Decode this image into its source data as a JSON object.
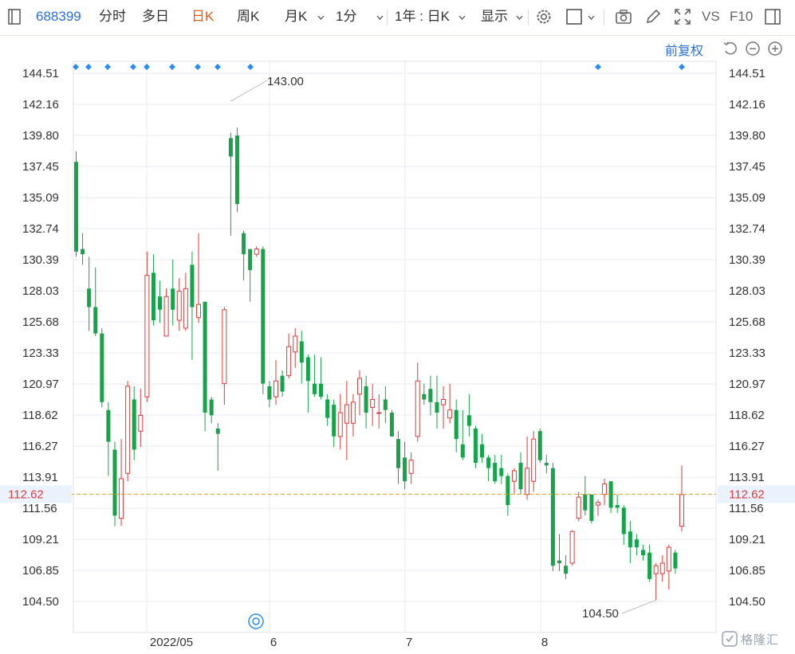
{
  "toolbar": {
    "stock_code": "688399",
    "tabs": [
      "分时",
      "多日",
      "日K",
      "周K",
      "月K",
      "1分"
    ],
    "active_tab": "日K",
    "period_select": "1年 : 日K",
    "display_label": "显示",
    "vs_label": "VS",
    "f10_label": "F10",
    "adjust_label": "前复权"
  },
  "colors": {
    "up": "#e03a3a",
    "down": "#17a34a",
    "grid": "#e8ebf0",
    "marker": "#2a8ef0",
    "price_line": "#d9a441",
    "price_label": "#e03a3a"
  },
  "chart_data": {
    "type": "candlestick",
    "y_ticks": [
      "144.51",
      "142.16",
      "139.80",
      "137.45",
      "135.09",
      "132.74",
      "130.39",
      "128.03",
      "125.68",
      "123.33",
      "120.97",
      "118.62",
      "116.27",
      "113.91",
      "111.56",
      "109.21",
      "106.85",
      "104.50"
    ],
    "x_labels": [
      "2022/05",
      "6",
      "7",
      "8"
    ],
    "current_price": "112.62",
    "high_label": "143.00",
    "low_label": "104.50",
    "candles": [
      [
        137.8,
        131.0,
        138.6,
        130.6
      ],
      [
        131.2,
        130.8,
        132.4,
        130.0
      ],
      [
        128.2,
        126.8,
        130.6,
        125.0
      ],
      [
        126.8,
        124.8,
        129.8,
        124.6
      ],
      [
        124.8,
        119.6,
        125.2,
        119.2
      ],
      [
        119.0,
        116.6,
        119.6,
        114.0
      ],
      [
        116.0,
        111.0,
        116.6,
        110.2
      ],
      [
        110.8,
        113.8,
        116.8,
        110.2
      ],
      [
        114.2,
        120.8,
        121.2,
        113.6
      ],
      [
        119.8,
        116.0,
        120.8,
        115.2
      ],
      [
        117.4,
        118.6,
        120.6,
        116.2
      ],
      [
        120.0,
        129.2,
        131.0,
        119.6
      ],
      [
        129.4,
        125.8,
        130.8,
        125.4
      ],
      [
        127.6,
        126.6,
        128.8,
        125.6
      ],
      [
        124.6,
        127.6,
        128.2,
        124.6
      ],
      [
        128.2,
        126.6,
        130.4,
        125.4
      ],
      [
        125.8,
        128.0,
        129.0,
        125.0
      ],
      [
        125.2,
        128.2,
        129.4,
        125.0
      ],
      [
        130.0,
        126.8,
        131.0,
        122.8
      ],
      [
        126.0,
        127.0,
        132.4,
        125.6
      ],
      [
        127.2,
        118.8,
        127.2,
        117.4
      ],
      [
        119.8,
        118.6,
        120.0,
        118.0
      ],
      [
        117.6,
        117.2,
        118.0,
        114.4
      ],
      [
        121.0,
        126.6,
        126.8,
        119.4
      ],
      [
        139.6,
        138.2,
        140.0,
        132.2
      ],
      [
        139.8,
        134.6,
        140.4,
        134.0
      ],
      [
        132.4,
        130.8,
        132.6,
        128.8
      ],
      [
        131.2,
        129.6,
        131.2,
        127.2
      ],
      [
        130.8,
        131.2,
        131.4,
        130.6
      ],
      [
        131.2,
        121.0,
        131.4,
        120.2
      ],
      [
        120.8,
        119.8,
        121.2,
        119.2
      ],
      [
        120.0,
        121.2,
        122.8,
        119.4
      ],
      [
        121.6,
        120.4,
        122.0,
        120.0
      ],
      [
        121.6,
        123.8,
        124.8,
        121.4
      ],
      [
        123.4,
        124.6,
        125.2,
        122.2
      ],
      [
        124.2,
        122.6,
        125.0,
        121.0
      ],
      [
        123.0,
        121.2,
        123.2,
        118.8
      ],
      [
        121.0,
        120.2,
        123.2,
        120.0
      ],
      [
        121.0,
        120.0,
        123.0,
        119.8
      ],
      [
        119.8,
        118.4,
        120.2,
        117.8
      ],
      [
        119.4,
        117.0,
        119.8,
        116.2
      ],
      [
        117.0,
        118.8,
        120.2,
        116.0
      ],
      [
        118.0,
        119.4,
        121.2,
        115.2
      ],
      [
        118.0,
        119.6,
        120.2,
        117.0
      ],
      [
        120.2,
        121.4,
        122.0,
        118.6
      ],
      [
        120.8,
        118.8,
        121.6,
        117.6
      ],
      [
        119.2,
        119.8,
        121.0,
        117.8
      ],
      [
        118.8,
        118.8,
        120.2,
        117.6
      ],
      [
        119.8,
        119.0,
        120.8,
        118.0
      ],
      [
        118.8,
        117.0,
        119.0,
        117.0
      ],
      [
        116.8,
        114.6,
        117.4,
        113.4
      ],
      [
        115.4,
        113.6,
        116.6,
        113.0
      ],
      [
        114.2,
        115.2,
        115.8,
        113.4
      ],
      [
        117.0,
        121.2,
        122.6,
        116.6
      ],
      [
        120.2,
        119.8,
        121.0,
        119.4
      ],
      [
        120.6,
        119.6,
        121.6,
        118.6
      ],
      [
        119.6,
        118.8,
        121.6,
        117.6
      ],
      [
        119.4,
        119.8,
        120.8,
        117.6
      ],
      [
        118.4,
        119.0,
        121.0,
        118.0
      ],
      [
        119.0,
        116.8,
        119.8,
        115.8
      ],
      [
        116.4,
        115.4,
        119.0,
        115.2
      ],
      [
        118.6,
        117.8,
        120.2,
        117.0
      ],
      [
        117.6,
        115.0,
        117.8,
        114.6
      ],
      [
        116.4,
        115.4,
        117.2,
        115.0
      ],
      [
        115.4,
        114.6,
        115.6,
        113.6
      ],
      [
        115.0,
        113.6,
        115.6,
        113.4
      ],
      [
        114.6,
        114.0,
        115.6,
        113.4
      ],
      [
        114.0,
        111.8,
        114.2,
        111.0
      ],
      [
        113.6,
        114.4,
        114.6,
        112.6
      ],
      [
        115.0,
        113.0,
        115.8,
        112.6
      ],
      [
        112.6,
        114.6,
        117.0,
        112.2
      ],
      [
        113.6,
        116.8,
        117.4,
        112.8
      ],
      [
        117.4,
        115.2,
        117.6,
        115.0
      ],
      [
        115.0,
        114.8,
        115.6,
        114.2
      ],
      [
        114.6,
        107.2,
        115.0,
        106.8
      ],
      [
        107.6,
        107.4,
        109.6,
        106.8
      ],
      [
        107.2,
        106.6,
        108.0,
        106.2
      ],
      [
        107.4,
        109.8,
        109.9,
        107.2
      ],
      [
        110.8,
        112.4,
        112.8,
        110.6
      ],
      [
        112.6,
        111.4,
        114.0,
        111.0
      ],
      [
        112.6,
        110.6,
        112.6,
        110.4
      ],
      [
        111.8,
        112.0,
        112.2,
        111.0
      ],
      [
        112.6,
        113.4,
        113.8,
        111.8
      ],
      [
        113.6,
        111.6,
        113.6,
        111.2
      ],
      [
        111.8,
        111.6,
        112.6,
        111.2
      ],
      [
        111.6,
        109.6,
        111.8,
        108.8
      ],
      [
        109.8,
        108.6,
        110.6,
        107.4
      ],
      [
        109.2,
        108.6,
        109.6,
        108.0
      ],
      [
        108.4,
        108.0,
        108.8,
        107.6
      ],
      [
        108.2,
        106.2,
        108.8,
        106.0
      ],
      [
        106.6,
        107.2,
        107.4,
        104.6
      ],
      [
        106.6,
        107.4,
        108.0,
        106.0
      ],
      [
        106.8,
        108.6,
        108.8,
        105.4
      ],
      [
        108.2,
        107.0,
        108.4,
        106.6
      ],
      [
        110.2,
        112.6,
        114.8,
        109.8
      ]
    ],
    "event_markers": [
      "marker",
      "marker",
      "marker",
      "marker",
      "marker",
      "marker",
      "marker",
      "marker",
      "marker",
      "marker"
    ]
  }
}
